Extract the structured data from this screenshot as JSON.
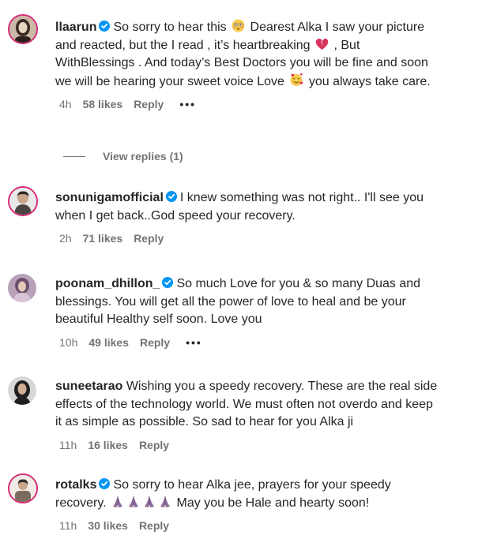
{
  "comments": [
    {
      "username": "llaarun",
      "verified": true,
      "segments": [
        "So sorry to hear this",
        "Dearest Alka I saw your picture and reacted, but the I read , it’s heartbreaking",
        ", But WithBlessings . And today’s Best Doctors you will be fine and soon we will be hearing your sweet voice Love",
        "you always take care."
      ],
      "emojis": [
        "flushed-face-emoji",
        "broken-heart-emoji",
        "smiling-face-with-hearts-emoji"
      ],
      "time": "4h",
      "likes": "58 likes",
      "reply": "Reply",
      "more": "•••",
      "view_replies": "View replies (1)",
      "avatar_colors": [
        "#c9b9a6",
        "#3b2a22",
        "#e8d6c4"
      ]
    },
    {
      "username": "sonunigamofficial",
      "verified": true,
      "text": "I knew something was not right.. I'll see you when I get back..God speed your recovery.",
      "time": "2h",
      "likes": "71 likes",
      "reply": "Reply",
      "avatar_colors": [
        "#e9e9e9",
        "#2e2a28",
        "#c7a58b"
      ]
    },
    {
      "username": "poonam_dhillon_",
      "verified": true,
      "text": "So much Love for you & so many Duas and blessings. You will get all the power of love to heal and be your beautiful Healthy self soon. Love you",
      "time": "10h",
      "likes": "49 likes",
      "reply": "Reply",
      "more": "•••",
      "avatar_colors": [
        "#b7a2b9",
        "#e6c9b8",
        "#6b4f6c"
      ]
    },
    {
      "username": "suneetarao",
      "verified": false,
      "text": "Wishing you a speedy recovery. These are the real side effects of the technology world. We must often not overdo and keep it as simple as possible. So sad to hear for you Alka ji",
      "time": "11h",
      "likes": "16 likes",
      "reply": "Reply",
      "avatar_colors": [
        "#d7d7d7",
        "#1f1f1f",
        "#d2ae95"
      ]
    },
    {
      "username": "rotalks",
      "verified": true,
      "segments": [
        "So sorry to hear Alka jee, prayers for your speedy recovery.",
        "May you be Hale and hearty soon!"
      ],
      "emojis": [
        "folded-hands-emoji",
        "folded-hands-emoji",
        "folded-hands-emoji",
        "folded-hands-emoji"
      ],
      "time": "11h",
      "likes": "30 likes",
      "reply": "Reply",
      "avatar_colors": [
        "#f1ede6",
        "#7a6c5d",
        "#2f2f2f"
      ]
    }
  ],
  "colors": {
    "text": "#262626",
    "meta": "#737373",
    "verified": "#0095f6",
    "story_ring": "#d62976"
  }
}
